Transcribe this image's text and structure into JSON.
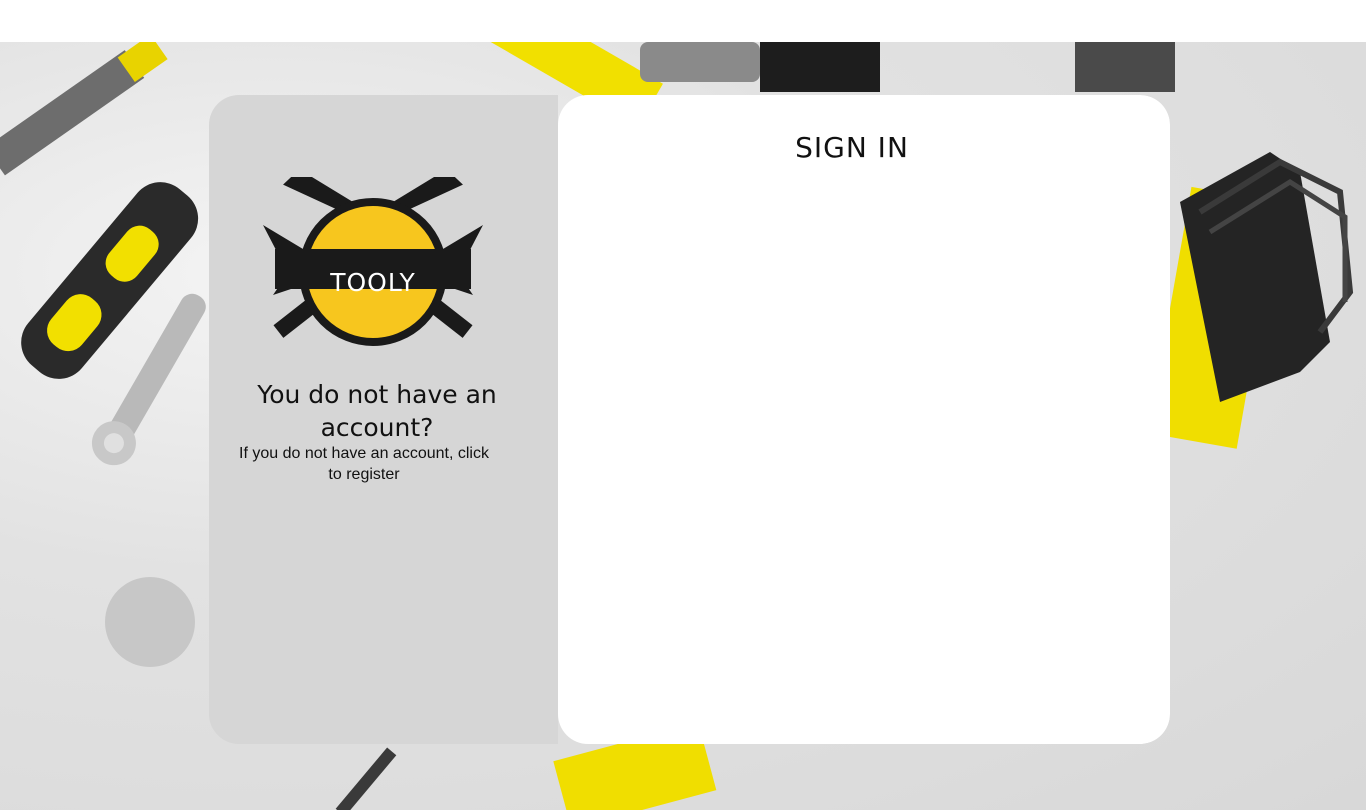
{
  "brand": {
    "logo_text": "TOOLY",
    "colors": {
      "yellow": "#f7c61e",
      "dark": "#1a1a1a"
    }
  },
  "register_panel": {
    "title": "You do not have an account?",
    "subtitle": "If you do not have an account, click to register"
  },
  "login_panel": {
    "title": "SIGN IN"
  }
}
